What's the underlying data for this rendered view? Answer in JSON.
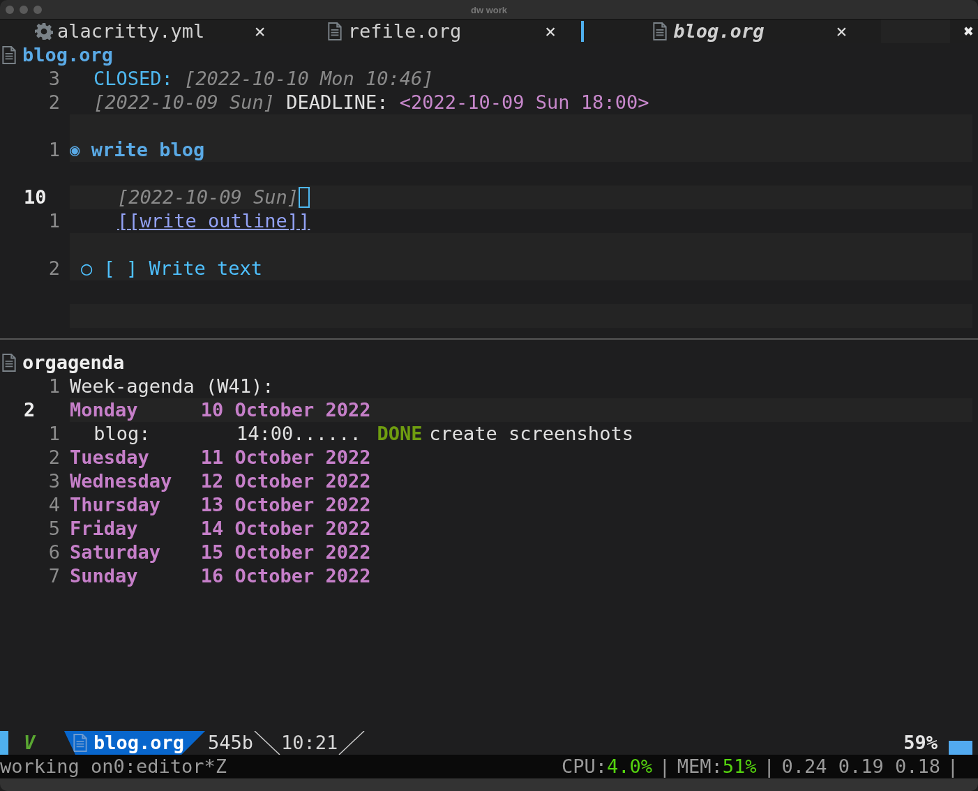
{
  "window": {
    "title": "dw work"
  },
  "tabs": [
    {
      "label": "alacritty.yml",
      "close": "×",
      "selected": false
    },
    {
      "label": "refile.org",
      "close": "×",
      "selected": false
    },
    {
      "label": "blog.org",
      "close": "×",
      "selected": true
    }
  ],
  "close_all": "✖",
  "top_pane": {
    "file": "blog.org",
    "active": true,
    "lines": [
      {
        "number": "3",
        "current": false,
        "kind": "drawer",
        "segments": [
          {
            "kind": "keyword",
            "text": "CLOSED:"
          },
          {
            "kind": "timestamp",
            "text": "[2022-10-10 Mon 10:46]"
          }
        ]
      },
      {
        "number": "2",
        "current": false,
        "kind": "drawer",
        "segments": [
          {
            "kind": "timestamp",
            "text": "[2022-10-09 Sun]"
          },
          {
            "kind": "plain",
            "text": "DEADLINE:"
          },
          {
            "kind": "deadline",
            "text": "<2022-10-09 Sun 18:00>"
          }
        ]
      },
      {
        "band": true,
        "kind": "blank"
      },
      {
        "number": "1",
        "current": false,
        "band": true,
        "kind": "heading",
        "segments": [
          {
            "kind": "bullet",
            "text": "◉"
          },
          {
            "kind": "heading",
            "text": "write blog"
          }
        ]
      },
      {
        "kind": "blank"
      },
      {
        "number": "10",
        "current": true,
        "band": true,
        "kind": "body",
        "cursor": true,
        "segments": [
          {
            "kind": "timestamp",
            "text": "[2022-10-09 Sun]"
          }
        ]
      },
      {
        "number": "1",
        "current": false,
        "kind": "body",
        "segments": [
          {
            "kind": "link",
            "text": "[[write outline]]"
          }
        ]
      },
      {
        "band": true,
        "kind": "blank"
      },
      {
        "number": "2",
        "current": false,
        "band": true,
        "kind": "subheading",
        "segments": [
          {
            "kind": "todo",
            "text": "○"
          },
          {
            "kind": "todo",
            "text": "[ ]"
          },
          {
            "kind": "todo",
            "text": "Write text"
          }
        ]
      },
      {
        "kind": "blank"
      },
      {
        "band": true,
        "kind": "blank"
      }
    ]
  },
  "bottom_pane": {
    "file": "orgagenda",
    "active": false,
    "lines": [
      {
        "number": "1",
        "current": false,
        "kind": "agenda",
        "segments": [
          {
            "kind": "plain",
            "text": "Week-agenda (W41):"
          }
        ]
      },
      {
        "number": "2",
        "current": true,
        "band": true,
        "kind": "agenda",
        "segments": [
          {
            "kind": "day",
            "text": "Monday"
          },
          {
            "kind": "date",
            "text": "10 October 2022"
          }
        ]
      },
      {
        "number": "1",
        "current": false,
        "kind": "agenda",
        "segments": [
          {
            "kind": "category",
            "text": "blog:"
          },
          {
            "kind": "time",
            "text": "14:00......"
          },
          {
            "kind": "done",
            "text": "DONE"
          },
          {
            "kind": "plain",
            "text": "create screenshots"
          }
        ]
      },
      {
        "number": "2",
        "current": false,
        "kind": "agenda",
        "segments": [
          {
            "kind": "day",
            "text": "Tuesday"
          },
          {
            "kind": "date",
            "text": "11 October 2022"
          }
        ]
      },
      {
        "number": "3",
        "current": false,
        "kind": "agenda",
        "segments": [
          {
            "kind": "day",
            "text": "Wednesday"
          },
          {
            "kind": "date",
            "text": "12 October 2022"
          }
        ]
      },
      {
        "number": "4",
        "current": false,
        "kind": "agenda",
        "segments": [
          {
            "kind": "day",
            "text": "Thursday"
          },
          {
            "kind": "date",
            "text": "13 October 2022"
          }
        ]
      },
      {
        "number": "5",
        "current": false,
        "kind": "agenda",
        "segments": [
          {
            "kind": "day",
            "text": "Friday"
          },
          {
            "kind": "date",
            "text": "14 October 2022"
          }
        ]
      },
      {
        "number": "6",
        "current": false,
        "kind": "agenda",
        "segments": [
          {
            "kind": "day",
            "text": "Saturday"
          },
          {
            "kind": "date",
            "text": "15 October 2022"
          }
        ]
      },
      {
        "number": "7",
        "current": false,
        "kind": "agenda",
        "segments": [
          {
            "kind": "day",
            "text": "Sunday"
          },
          {
            "kind": "date",
            "text": "16 October 2022"
          }
        ]
      }
    ]
  },
  "modeline": {
    "mode": "V",
    "file": "blog.org",
    "size": "545b",
    "position": "10:21",
    "percent": "59%"
  },
  "status_bar": {
    "left": "working on0:editor*Z",
    "right": [
      {
        "kind": "label",
        "text": "CPU:"
      },
      {
        "kind": "value",
        "text": "4.0%"
      },
      {
        "kind": "sep",
        "text": "|"
      },
      {
        "kind": "label",
        "text": "MEM:"
      },
      {
        "kind": "value",
        "text": "51%"
      },
      {
        "kind": "sep",
        "text": "|"
      },
      {
        "kind": "label",
        "text": "0.24 0.19 0.18"
      },
      {
        "kind": "sep",
        "text": "|"
      }
    ]
  }
}
